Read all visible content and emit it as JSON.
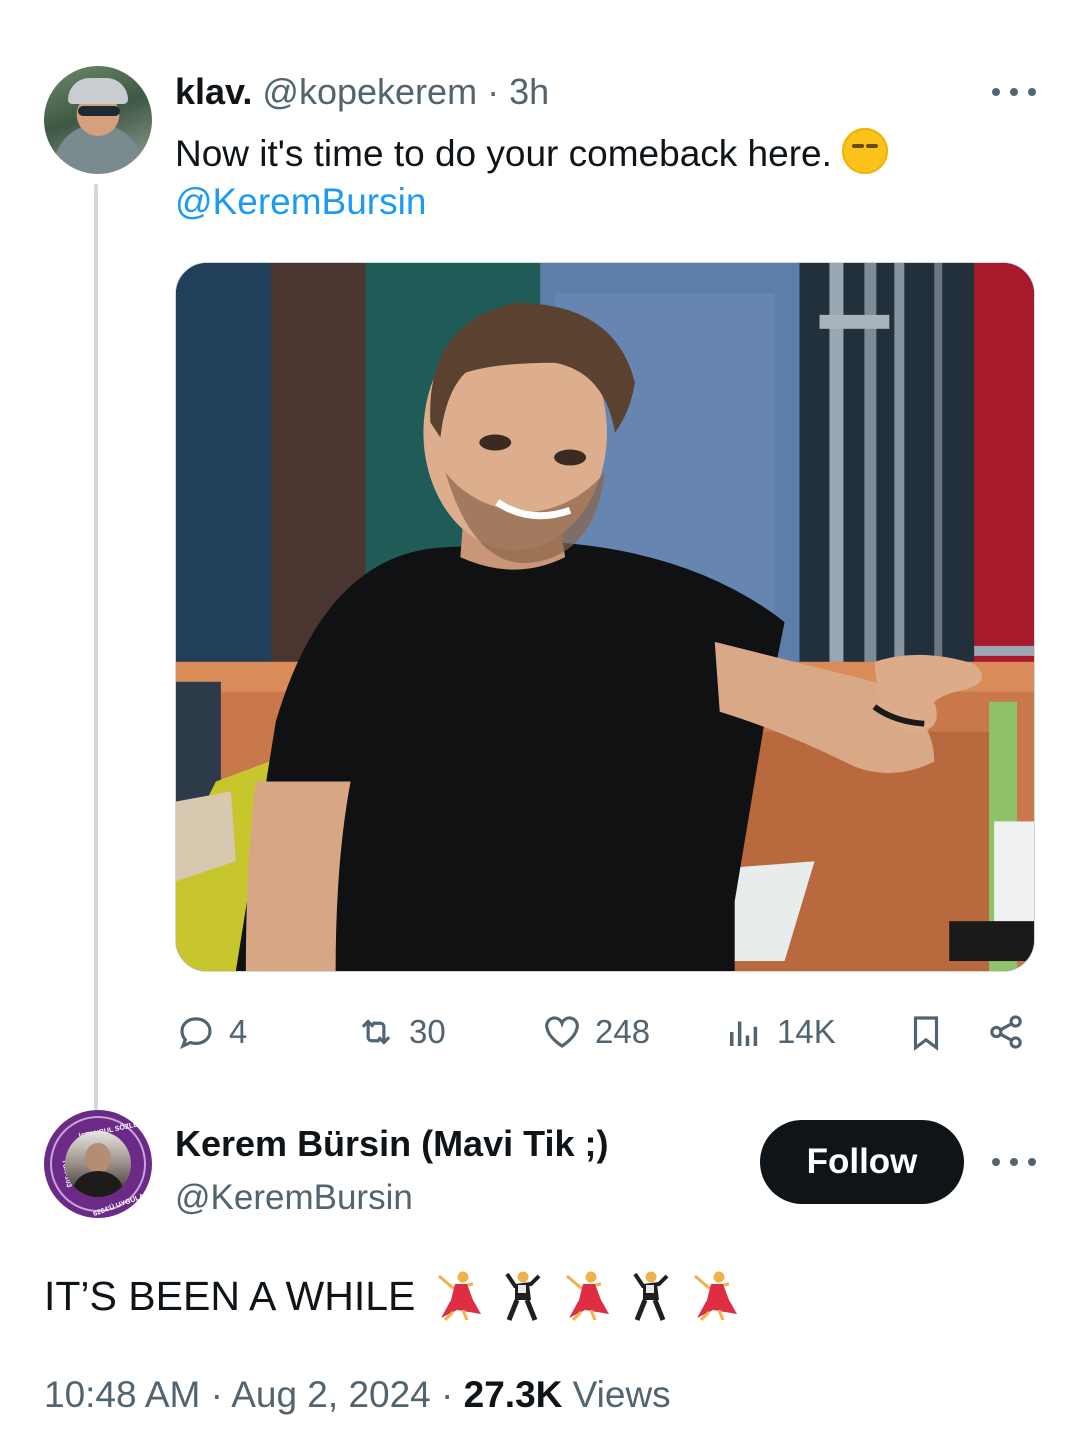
{
  "parent_tweet": {
    "display_name": "klav.",
    "handle": "@kopekerem",
    "separator": " · ",
    "time": "3h",
    "text": "Now it's time to do your comeback here.",
    "emoji": "smirking-face",
    "mention": "@KeremBursin",
    "stats": {
      "replies": "4",
      "reposts": "30",
      "likes": "248",
      "views": "14K"
    }
  },
  "reply_tweet": {
    "display_name": "Kerem Bürsin (Mavi Tik ;)",
    "handle": "@KeremBursin",
    "follow_label": "Follow",
    "avatar_badge_text": "İSTANBUL SÖZLEŞMESİ YAŞATIR",
    "avatar_badge_text_bottom": "6284'Ü UYGULA",
    "avatar_badge_text_left": "TCK-103",
    "text": "IT’S BEEN A WHILE",
    "emojis": [
      "woman-dancing",
      "man-dancing",
      "woman-dancing",
      "man-dancing",
      "woman-dancing"
    ],
    "time": "10:48 AM",
    "date": "Aug 2, 2024",
    "sep": " · ",
    "views_count": "27.3K",
    "views_label": " Views"
  },
  "colors": {
    "text": "#0f1419",
    "muted": "#536471",
    "link": "#1d9bf0",
    "follow_bg": "#0f1419",
    "thread_line": "#cfd9de"
  }
}
